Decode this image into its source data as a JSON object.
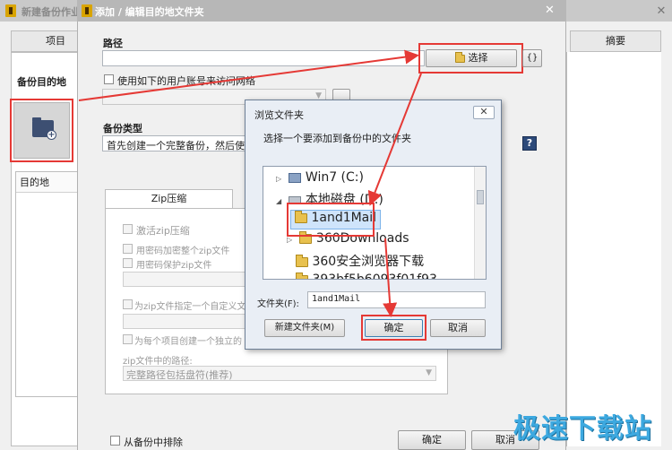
{
  "background_window": {
    "title": "新建备份作业",
    "close_glyph": "✕",
    "tab_left": "项目",
    "tab_right": "摘要",
    "section_label": "备份目的地",
    "list_header": "目的地"
  },
  "edit_dialog": {
    "title": "添加 / 编辑目的地文件夹",
    "path_label": "路径",
    "path_value": "",
    "select_button": "选择",
    "brace_button": "{}",
    "use_account_label": "使用如下的用户账号来访问网络",
    "backup_type_label": "备份类型",
    "backup_type_value": "首先创建一个完整备份，然后使用",
    "help_button": "?",
    "zip_tab": "Zip压缩",
    "zip_options": {
      "activate": "激活zip压缩",
      "encrypt_header": "用密码加密整个zip文件",
      "password_protect": "用密码保护zip文件",
      "custom_name": "为zip文件指定一个自定义文",
      "per_item": "为每个项目创建一个独立的",
      "path_label": "zip文件中的路径:",
      "path_select": "完整路径包括盘符(推荐)"
    },
    "exclude_label": "从备份中排除",
    "ok_button": "确定",
    "cancel_button": "取消"
  },
  "browse_dialog": {
    "title": "浏览文件夹",
    "close_glyph": "✕",
    "prompt": "选择一个要添加到备份中的文件夹",
    "tree": [
      {
        "label": "Win7 (C:)"
      },
      {
        "label": "本地磁盘 (D:)"
      },
      {
        "label": "1and1Mail"
      },
      {
        "label": "360Downloads"
      },
      {
        "label": "360安全浏览器下载"
      },
      {
        "label": "393bf5b6093f01f93"
      }
    ],
    "folder_label": "文件夹(F):",
    "folder_value": "1and1Mail",
    "new_folder_button": "新建文件夹(M)",
    "ok_button": "确定",
    "cancel_button": "取消"
  },
  "watermark": "极速下载站",
  "colors": {
    "annotation_red": "#e53935",
    "help_blue": "#2d4a7a",
    "watermark_blue": "#3da9e0"
  }
}
